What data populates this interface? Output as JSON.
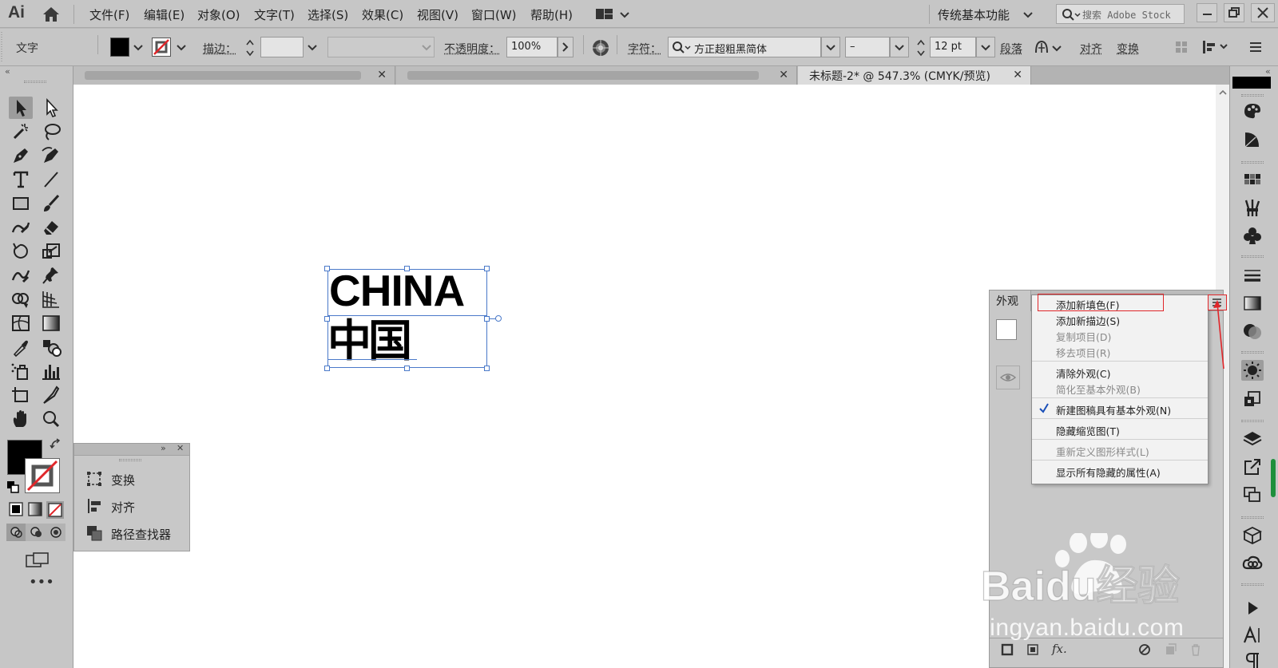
{
  "app": {
    "logo": "Ai"
  },
  "menu": {
    "items": [
      "文件(F)",
      "编辑(E)",
      "对象(O)",
      "文字(T)",
      "选择(S)",
      "效果(C)",
      "视图(V)",
      "窗口(W)",
      "帮助(H)"
    ]
  },
  "workspace": {
    "name": "传统基本功能"
  },
  "stock_search": {
    "placeholder": "搜索 Adobe Stock"
  },
  "control": {
    "selection_type": "文字",
    "fill_color": "#000000",
    "stroke_label": "描边：",
    "opacity_label": "不透明度：",
    "opacity_value": "100%",
    "char_label": "字符：",
    "font_family": "方正超粗黑简体",
    "font_style": "–",
    "font_size": "12 pt",
    "paragraph_label": "段落",
    "align_label": "对齐",
    "transform_label": "变换"
  },
  "tabs": [
    {
      "title": "",
      "blurred": true
    },
    {
      "title": "",
      "blurred": true
    },
    {
      "title": "未标题-2* @ 547.3% (CMYK/预览)",
      "active": true
    }
  ],
  "canvas": {
    "text_line1": "CHINA",
    "text_line2": "中国"
  },
  "float_panel": {
    "items": [
      "变换",
      "对齐",
      "路径查找器"
    ]
  },
  "appearance_panel": {
    "title": "外观"
  },
  "context_menu": {
    "items": [
      {
        "label": "添加新填色(F)",
        "enabled": true,
        "highlighted": true
      },
      {
        "label": "添加新描边(S)",
        "enabled": true
      },
      {
        "label": "复制项目(D)",
        "enabled": false
      },
      {
        "label": "移去项目(R)",
        "enabled": false
      },
      {
        "label": "清除外观(C)",
        "enabled": true
      },
      {
        "label": "简化至基本外观(B)",
        "enabled": false
      },
      {
        "label": "新建图稿具有基本外观(N)",
        "enabled": true,
        "checked": true
      },
      {
        "label": "隐藏缩览图(T)",
        "enabled": true
      },
      {
        "label": "重新定义图形样式(L)",
        "enabled": false
      },
      {
        "label": "显示所有隐藏的属性(A)",
        "enabled": true
      }
    ]
  },
  "watermark": {
    "text": "Baidu经验",
    "url": "jingyan.baidu.com"
  },
  "colors": {
    "highlight_red": "#e0262a",
    "check_blue": "#1a4fb8"
  }
}
